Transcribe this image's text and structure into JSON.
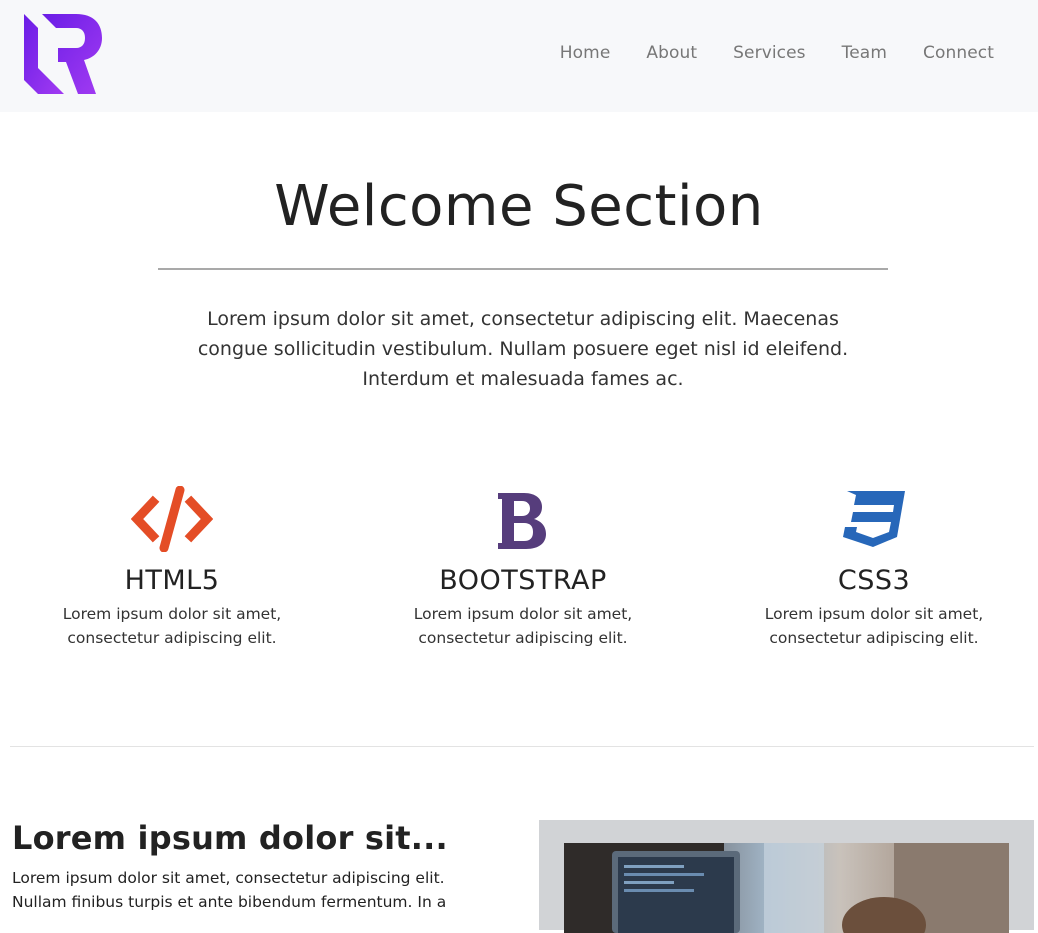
{
  "nav": {
    "logo_icon": "brand-logo-icon",
    "links": [
      "Home",
      "About",
      "Services",
      "Team",
      "Connect"
    ]
  },
  "welcome": {
    "title": "Welcome Section",
    "text": "Lorem ipsum dolor sit amet, consectetur adipiscing elit. Maecenas congue sollicitudin vestibulum. Nullam posuere eget nisl id eleifend. Interdum et malesuada fames ac."
  },
  "features": [
    {
      "icon": "html5-code-icon",
      "title": "HTML5",
      "text": "Lorem ipsum dolor sit amet, consectetur adipiscing elit.",
      "color": "#e44d26"
    },
    {
      "icon": "bootstrap-icon",
      "title": "BOOTSTRAP",
      "text": "Lorem ipsum dolor sit amet, consectetur adipiscing elit.",
      "color": "#563d7c"
    },
    {
      "icon": "css3-icon",
      "title": "CSS3",
      "text": "Lorem ipsum dolor sit amet, consectetur adipiscing elit.",
      "color": "#2965f1"
    }
  ],
  "about": {
    "title": "Lorem ipsum dolor sit...",
    "text": "Lorem ipsum dolor sit amet, consectetur adipiscing elit. Nullam finibus turpis et ante bibendum fermentum. In a",
    "image": "workspace-photo"
  },
  "colors": {
    "brand": "#7b2ff7",
    "nav_bg": "#f7f8fa"
  }
}
